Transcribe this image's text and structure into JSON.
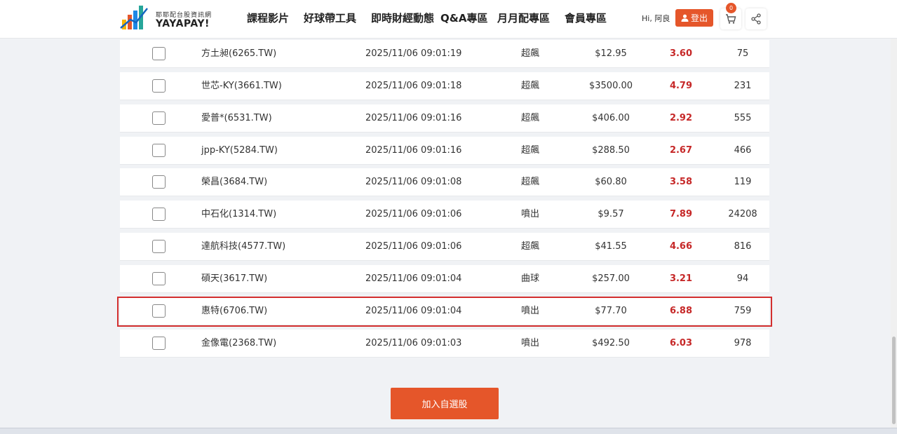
{
  "header": {
    "logo_sub": "耶耶配台股資訊網",
    "logo_main": "YAYAPAY!",
    "nav": [
      "課程影片",
      "好球帶工具",
      "即時財經動態",
      "Q&A專區",
      "月月配專區",
      "會員專區"
    ],
    "greeting": "Hi,  阿良",
    "logout_label": "登出",
    "cart_count": "0"
  },
  "rows": [
    {
      "name": "方土昶(6265.TW)",
      "time": "2025/11/06 09:01:19",
      "type": "超飆",
      "price": "$12.95",
      "pct": "3.60",
      "vol": "75"
    },
    {
      "name": "世芯-KY(3661.TW)",
      "time": "2025/11/06 09:01:18",
      "type": "超飆",
      "price": "$3500.00",
      "pct": "4.79",
      "vol": "231"
    },
    {
      "name": "愛普*(6531.TW)",
      "time": "2025/11/06 09:01:16",
      "type": "超飆",
      "price": "$406.00",
      "pct": "2.92",
      "vol": "555"
    },
    {
      "name": "jpp-KY(5284.TW)",
      "time": "2025/11/06 09:01:16",
      "type": "超飆",
      "price": "$288.50",
      "pct": "2.67",
      "vol": "466"
    },
    {
      "name": "榮昌(3684.TW)",
      "time": "2025/11/06 09:01:08",
      "type": "超飆",
      "price": "$60.80",
      "pct": "3.58",
      "vol": "119"
    },
    {
      "name": "中石化(1314.TW)",
      "time": "2025/11/06 09:01:06",
      "type": "噴出",
      "price": "$9.57",
      "pct": "7.89",
      "vol": "24208"
    },
    {
      "name": "達航科技(4577.TW)",
      "time": "2025/11/06 09:01:06",
      "type": "超飆",
      "price": "$41.55",
      "pct": "4.66",
      "vol": "816"
    },
    {
      "name": "碩天(3617.TW)",
      "time": "2025/11/06 09:01:04",
      "type": "曲球",
      "price": "$257.00",
      "pct": "3.21",
      "vol": "94"
    },
    {
      "name": "惠特(6706.TW)",
      "time": "2025/11/06 09:01:04",
      "type": "噴出",
      "price": "$77.70",
      "pct": "6.88",
      "vol": "759"
    },
    {
      "name": "金像電(2368.TW)",
      "time": "2025/11/06 09:01:03",
      "type": "噴出",
      "price": "$492.50",
      "pct": "6.03",
      "vol": "978"
    }
  ],
  "add_button_label": "加入自選股",
  "colors": {
    "accent": "#e5562a",
    "positive": "#c62828",
    "highlight_border": "#d32f2f"
  }
}
